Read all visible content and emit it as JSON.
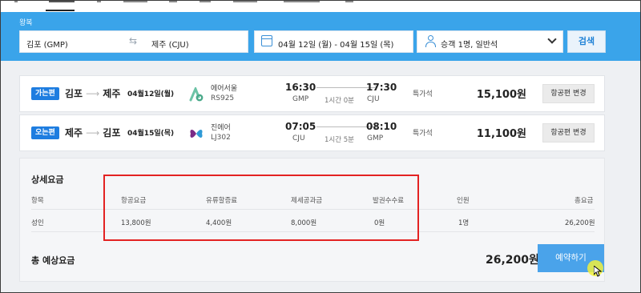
{
  "search": {
    "trip_type": "왕복",
    "from": "김포 (GMP)",
    "to": "제주 (CJU)",
    "dates": "04월 12일 (월) - 04월 15일 (목)",
    "passengers": "승객 1명, 일반석",
    "search_label": "검색"
  },
  "flights": [
    {
      "badge": "가는편",
      "from": "김포",
      "to": "제주",
      "date": "04월12일(월)",
      "airline": "에어서울",
      "flight_no": "RS925",
      "dep_time": "16:30",
      "dep_airport": "GMP",
      "duration": "1시간 0분",
      "arr_time": "17:30",
      "arr_airport": "CJU",
      "fare_class": "특가석",
      "price": "15,100원",
      "change_label": "항공편 변경",
      "logo_color": "#6cc3a6"
    },
    {
      "badge": "오는편",
      "from": "제주",
      "to": "김포",
      "date": "04월15일(목)",
      "airline": "진에어",
      "flight_no": "LJ302",
      "dep_time": "07:05",
      "dep_airport": "CJU",
      "duration": "1시간 5분",
      "arr_time": "08:10",
      "arr_airport": "GMP",
      "fare_class": "특가석",
      "price": "11,100원",
      "change_label": "항공편 변경",
      "logo_color": "#7a2b86"
    }
  ],
  "detail": {
    "title": "상세요금",
    "headers": [
      "항목",
      "항공요금",
      "유류할증료",
      "제세공과금",
      "발권수수료",
      "인원",
      "총요금"
    ],
    "row": [
      "성인",
      "13,800원",
      "4,400원",
      "8,000원",
      "0원",
      "1명",
      "26,200원"
    ],
    "total_label": "총 예상요금",
    "total_amount": "26,200원",
    "book_label": "예약하기"
  },
  "colors": {
    "header_blue": "#3aa4ea",
    "badge_blue": "#1e7de0",
    "highlight_red": "#e32222",
    "book_button": "#4aa3ea"
  }
}
